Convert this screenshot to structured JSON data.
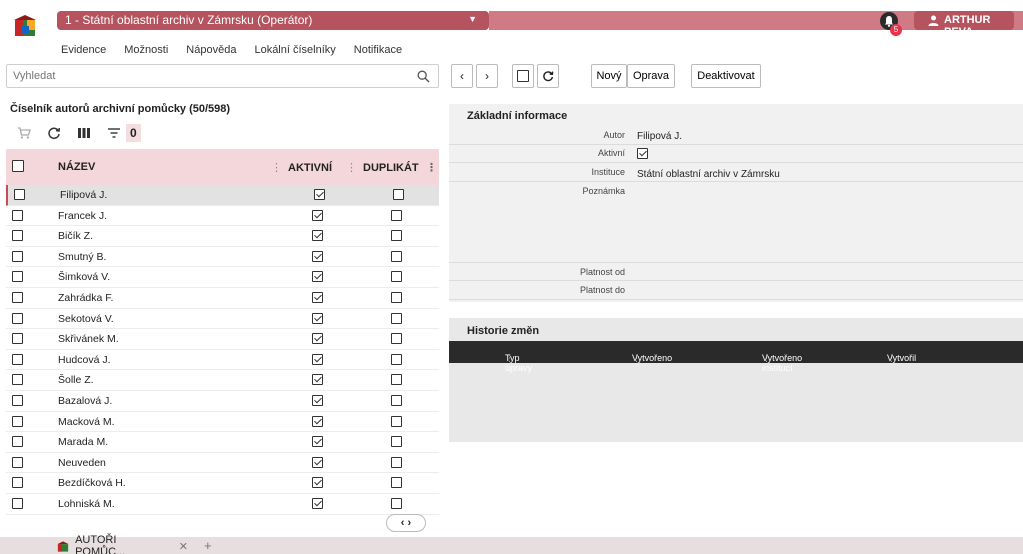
{
  "header": {
    "context_label": "1 - Státní oblastní archiv v Zámrsku  (Operátor)",
    "notification_count": "5",
    "user_name": "ARTHUR PEVA"
  },
  "menu": [
    "Evidence",
    "Možnosti",
    "Nápověda",
    "Lokální číselníky",
    "Notifikace"
  ],
  "search": {
    "placeholder": "Vyhledat"
  },
  "list": {
    "title": "Číselník autorů archivní pomůcky (50/598)",
    "filter_count": "0",
    "columns": {
      "name": "NÁZEV",
      "active": "AKTIVNÍ",
      "duplicate": "DUPLIKÁT"
    },
    "rows": [
      {
        "name": "Filipová J.",
        "active": true,
        "duplicate": false,
        "selected": true
      },
      {
        "name": "Francek J.",
        "active": true,
        "duplicate": false
      },
      {
        "name": "Bičík Z.",
        "active": true,
        "duplicate": false
      },
      {
        "name": "Smutný B.",
        "active": true,
        "duplicate": false
      },
      {
        "name": "Šimková V.",
        "active": true,
        "duplicate": false
      },
      {
        "name": "Zahrádka F.",
        "active": true,
        "duplicate": false
      },
      {
        "name": "Sekotová V.",
        "active": true,
        "duplicate": false
      },
      {
        "name": "Skřivánek M.",
        "active": true,
        "duplicate": false
      },
      {
        "name": "Hudcová J.",
        "active": true,
        "duplicate": false
      },
      {
        "name": "Šolle Z.",
        "active": true,
        "duplicate": false
      },
      {
        "name": "Bazalová J.",
        "active": true,
        "duplicate": false
      },
      {
        "name": "Macková M.",
        "active": true,
        "duplicate": false
      },
      {
        "name": "Marada M.",
        "active": true,
        "duplicate": false
      },
      {
        "name": "Neuveden",
        "active": true,
        "duplicate": false
      },
      {
        "name": "Bezdíčková H.",
        "active": true,
        "duplicate": false
      },
      {
        "name": "Lohniská M.",
        "active": true,
        "duplicate": false
      }
    ]
  },
  "toolbar": {
    "new_label": "Nový",
    "edit_label": "Oprava",
    "deactivate_label": "Deaktivovat"
  },
  "detail": {
    "section_title": "Základní informace",
    "author_label": "Autor",
    "author_value": "Filipová J.",
    "active_label": "Aktivní",
    "active_value": true,
    "institution_label": "Instituce",
    "institution_value": "Státní oblastní archiv v Zámrsku",
    "note_label": "Poznámka",
    "valid_from_label": "Platnost od",
    "valid_to_label": "Platnost do"
  },
  "history": {
    "title": "Historie změn",
    "columns": [
      "Typ úpravy",
      "Vytvořeno",
      "Vytvořeno institucí",
      "Vytvořil"
    ]
  },
  "tabs": [
    {
      "label": "AUTOŘI POMŮC..."
    }
  ],
  "colors": {
    "accent": "#b5535f",
    "header_light": "#cf7a85",
    "grid_header": "#f3d7da"
  }
}
